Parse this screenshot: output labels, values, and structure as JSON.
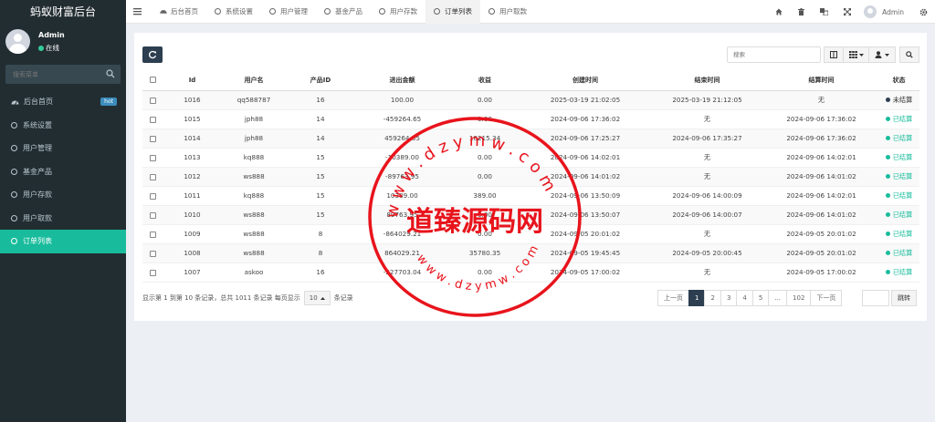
{
  "brand": "蚂蚁财富后台",
  "user": {
    "name": "Admin",
    "status": "在线"
  },
  "sidebar": {
    "search_placeholder": "搜索菜单",
    "items": [
      {
        "label": "后台首页",
        "badge": "hot"
      },
      {
        "label": "系统设置"
      },
      {
        "label": "用户管理"
      },
      {
        "label": "基金产品"
      },
      {
        "label": "用户存款"
      },
      {
        "label": "用户取款"
      },
      {
        "label": "订单列表"
      }
    ]
  },
  "tabs": [
    "后台首页",
    "系统设置",
    "用户管理",
    "基金产品",
    "用户存款",
    "订单列表",
    "用户取款"
  ],
  "topbar": {
    "admin": "Admin"
  },
  "toolbar": {
    "search_placeholder": "搜索"
  },
  "table": {
    "headers": [
      "Id",
      "用户名",
      "产品ID",
      "进出金额",
      "收益",
      "创建时间",
      "结束时间",
      "结算时间",
      "状态"
    ],
    "rows": [
      [
        "1016",
        "qq588787",
        "16",
        "100.00",
        "0.00",
        "2025-03-19 21:02:05",
        "2025-03-19 21:12:05",
        "无",
        "未结算"
      ],
      [
        "1015",
        "jph88",
        "14",
        "-459264.65",
        "0.00",
        "2024-09-06 17:36:02",
        "无",
        "2024-09-06 17:36:02",
        "已结算"
      ],
      [
        "1014",
        "jph88",
        "14",
        "459264.65",
        "18215.34",
        "2024-09-06 17:25:27",
        "2024-09-06 17:35:27",
        "2024-09-06 17:36:02",
        "已结算"
      ],
      [
        "1013",
        "kq888",
        "15",
        "-10389.00",
        "0.00",
        "2024-09-06 14:02:01",
        "无",
        "2024-09-06 14:02:01",
        "已结算"
      ],
      [
        "1012",
        "ws888",
        "15",
        "-89763.95",
        "0.00",
        "2024-09-06 14:01:02",
        "无",
        "2024-09-06 14:01:02",
        "已结算"
      ],
      [
        "1011",
        "kq888",
        "15",
        "10389.00",
        "389.00",
        "2024-09-06 13:50:09",
        "2024-09-06 14:00:09",
        "2024-09-06 14:02:01",
        "已结算"
      ],
      [
        "1010",
        "ws888",
        "15",
        "89763.95",
        "0.00",
        "2024-09-06 13:50:07",
        "2024-09-06 14:00:07",
        "2024-09-06 14:01:02",
        "已结算"
      ],
      [
        "1009",
        "ws888",
        "8",
        "-864029.21",
        "0.00",
        "2024-09-05 20:01:02",
        "无",
        "2024-09-05 20:01:02",
        "已结算"
      ],
      [
        "1008",
        "ws888",
        "8",
        "864029.21",
        "35780.35",
        "2024-09-05 19:45:45",
        "2024-09-05 20:00:45",
        "2024-09-05 20:01:02",
        "已结算"
      ],
      [
        "1007",
        "askoo",
        "16",
        "-227703.04",
        "0.00",
        "2024-09-05 17:00:02",
        "无",
        "2024-09-05 17:00:02",
        "已结算"
      ]
    ]
  },
  "pager": {
    "info_prefix": "显示第 1 到第 10 条记录，总共 1011 条记录 每页显示",
    "page_size": "10",
    "info_suffix": "条记录",
    "prev": "上一页",
    "pages": [
      "1",
      "2",
      "3",
      "4",
      "5",
      "...",
      "102"
    ],
    "next": "下一页",
    "jump": "跳转"
  },
  "watermark": {
    "text": "道臻源码网",
    "ring_top": "w w w . d z y m w . c o m",
    "ring_bottom": "w w w . d z y m w . c o m"
  },
  "colors": {
    "sidebar": "#222d32",
    "accent": "#18bc9c",
    "primary": "#2c3e50",
    "stamp": "#e8141c"
  }
}
